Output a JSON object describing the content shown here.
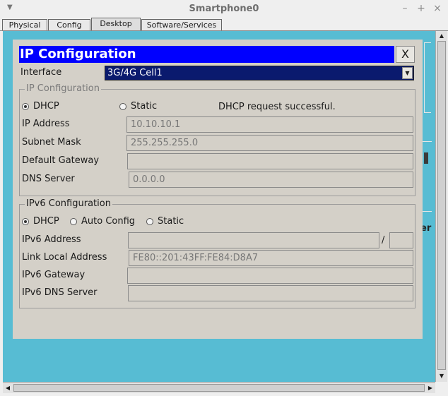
{
  "window": {
    "title": "Smartphone0",
    "controls": [
      "–",
      "+",
      "×"
    ]
  },
  "tabs": [
    {
      "label": "Physical"
    },
    {
      "label": "Config"
    },
    {
      "label": "Desktop",
      "active": true
    },
    {
      "label": "Software/Services"
    }
  ],
  "background_clip_text": "er",
  "panel": {
    "title": "IP Configuration",
    "close_label": "X",
    "interface_label": "Interface",
    "interface_value": "3G/4G Cell1",
    "ipv4": {
      "legend": "IP Configuration",
      "dhcp_label": "DHCP",
      "static_label": "Static",
      "selected": "DHCP",
      "status": "DHCP request successful.",
      "ip_address_label": "IP Address",
      "ip_address": "10.10.10.1",
      "subnet_mask_label": "Subnet Mask",
      "subnet_mask": "255.255.255.0",
      "default_gateway_label": "Default Gateway",
      "default_gateway": "",
      "dns_server_label": "DNS Server",
      "dns_server": "0.0.0.0"
    },
    "ipv6": {
      "legend": "IPv6 Configuration",
      "dhcp_label": "DHCP",
      "auto_label": "Auto Config",
      "static_label": "Static",
      "selected": "DHCP",
      "address_label": "IPv6 Address",
      "address": "",
      "prefix_separator": "/",
      "prefix": "",
      "link_local_label": "Link Local Address",
      "link_local": "FE80::201:43FF:FE84:D8A7",
      "gateway_label": "IPv6 Gateway",
      "gateway": "",
      "dns_label": "IPv6 DNS Server",
      "dns": ""
    }
  },
  "colors": {
    "desktop": "#57bcd3",
    "panel": "#d4d0c8",
    "title_bar": "#0000ff",
    "selected_interface": "#0a1a6e"
  }
}
